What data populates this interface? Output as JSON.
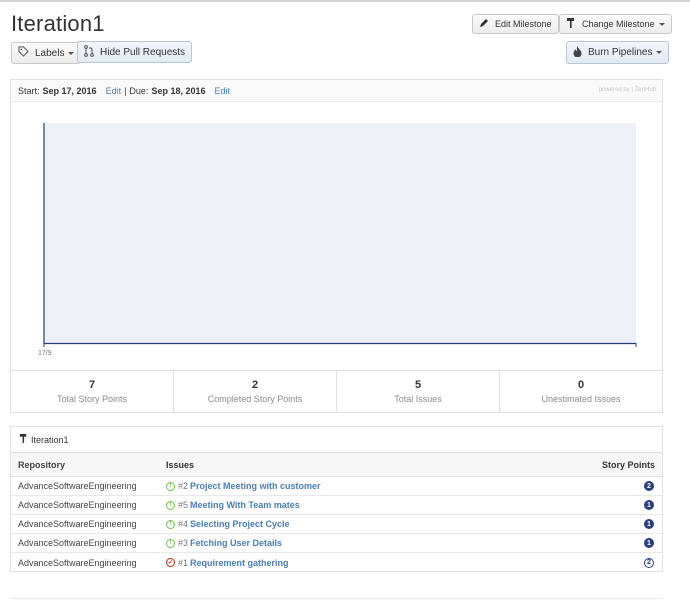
{
  "milestone_title": "Iteration1",
  "toolbar": {
    "labels_label": "Labels",
    "hide_pr_label": "Hide Pull Requests",
    "edit_milestone_label": "Edit Milestone",
    "change_milestone_label": "Change Milestone",
    "burn_pipelines_label": "Burn Pipelines"
  },
  "dates": {
    "start_prefix": "Start:",
    "start_value": "Sep 17, 2016",
    "start_edit": "Edit",
    "separator": "|",
    "due_prefix": "Due:",
    "due_value": "Sep 18, 2016",
    "due_edit": "Edit",
    "powered_by": "powered by | ZenHub"
  },
  "chart_data": {
    "type": "line",
    "x_tick_labels": [
      "17/9"
    ],
    "series": [],
    "plot_background": "#eef0f7",
    "axis_color": "#273f7c"
  },
  "stats": [
    {
      "value": "7",
      "label": "Total Story Points"
    },
    {
      "value": "2",
      "label": "Completed Story Points"
    },
    {
      "value": "5",
      "label": "Total Issues"
    },
    {
      "value": "0",
      "label": "Unestimated Issues"
    }
  ],
  "issues_table": {
    "milestone_label": "Iteration1",
    "columns": [
      "Repository",
      "Issues",
      "Story Points"
    ],
    "rows": [
      {
        "repo": "AdvanceSoftwareEngineering",
        "num": "#2",
        "title": "Project Meeting with customer",
        "points": "2",
        "state": "open"
      },
      {
        "repo": "AdvanceSoftwareEngineering",
        "num": "#5",
        "title": "Meeting With Team mates",
        "points": "1",
        "state": "open"
      },
      {
        "repo": "AdvanceSoftwareEngineering",
        "num": "#4",
        "title": "Selecting Project Cycle",
        "points": "1",
        "state": "open"
      },
      {
        "repo": "AdvanceSoftwareEngineering",
        "num": "#3",
        "title": "Fetching User Details",
        "points": "1",
        "state": "open"
      },
      {
        "repo": "AdvanceSoftwareEngineering",
        "num": "#1",
        "title": "Requirement gathering",
        "points": "2",
        "state": "closed"
      }
    ]
  },
  "colors": {
    "link": "#4a7fb5",
    "open_issue": "#6cc644",
    "closed_issue": "#bd2c00",
    "story_point_badge": "#273f7c"
  }
}
